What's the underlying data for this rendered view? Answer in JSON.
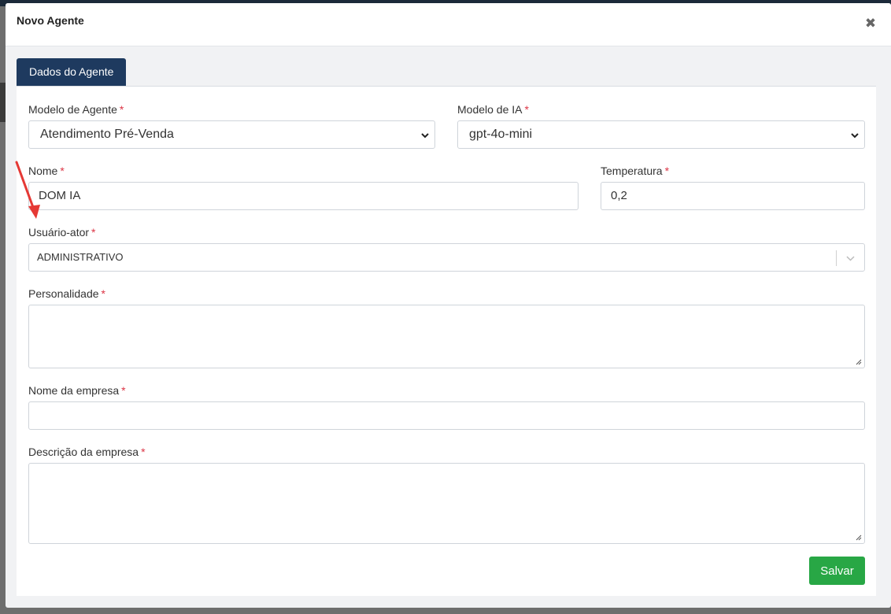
{
  "modal": {
    "title": "Novo Agente"
  },
  "tabs": [
    {
      "label": "Dados do Agente"
    }
  ],
  "form": {
    "agent_model": {
      "label": "Modelo de Agente",
      "required": "*",
      "value": "Atendimento Pré-Venda"
    },
    "ai_model": {
      "label": "Modelo de IA",
      "required": "*",
      "value": "gpt-4o-mini"
    },
    "name": {
      "label": "Nome",
      "required": "*",
      "value": "DOM IA"
    },
    "temperature": {
      "label": "Temperatura",
      "required": "*",
      "value": "0,2"
    },
    "actor_user": {
      "label": "Usuário-ator",
      "required": "*",
      "value": "ADMINISTRATIVO"
    },
    "personality": {
      "label": "Personalidade",
      "required": "*",
      "value": ""
    },
    "company_name": {
      "label": "Nome da empresa",
      "required": "*",
      "value": ""
    },
    "company_description": {
      "label": "Descrição da empresa",
      "required": "*",
      "value": ""
    }
  },
  "actions": {
    "save_label": "Salvar"
  },
  "colors": {
    "tab": "#1e3a5f",
    "save": "#28a745",
    "required": "#dc3545",
    "annotation": "#e53935"
  },
  "icons": {
    "close": "close-icon",
    "select": "chevron-down-icon"
  }
}
